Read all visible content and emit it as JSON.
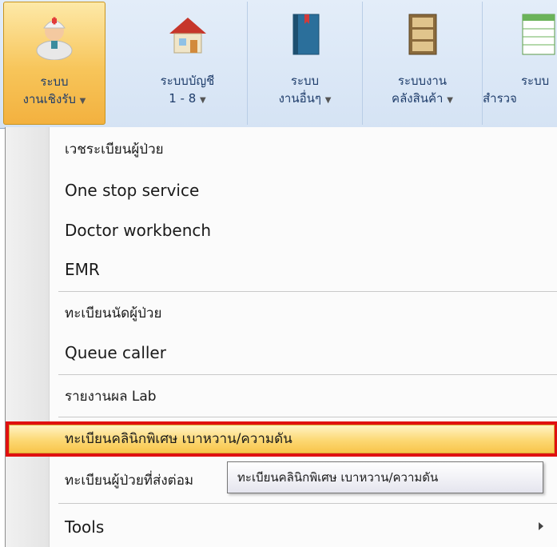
{
  "ribbon": {
    "buttons": [
      {
        "line1": "ระบบ",
        "line2": "งานเชิงรับ",
        "icon": "nurse-icon",
        "active": true
      },
      {
        "line1": "ระบบบัญชี",
        "line2": "1 - 8",
        "icon": "house-icon"
      },
      {
        "line1": "ระบบ",
        "line2": "งานอื่นๆ",
        "icon": "book-icon"
      },
      {
        "line1": "ระบบงาน",
        "line2": "คลังสินค้า",
        "icon": "cabinet-icon"
      },
      {
        "line1": "ระบบ",
        "line2": "สำรวจ",
        "icon": "sheet-icon"
      }
    ]
  },
  "menu": {
    "items": [
      "เวชระเบียนผู้ป่วย",
      "One stop service",
      "Doctor workbench",
      "EMR",
      "ทะเบียนนัดผู้ป่วย",
      "Queue caller",
      "รายงานผล Lab",
      "ทะเบียนคลินิกพิเศษ เบาหวาน/ความดัน",
      "ทะเบียนผู้ป่วยที่ส่งต่อม",
      "Tools"
    ],
    "highlighted_index": 7
  },
  "tooltip": {
    "text": "ทะเบียนคลินิกพิเศษ เบาหวาน/ความดัน"
  },
  "colors": {
    "ribbon_bg": "#dbe7f6",
    "active_button": "#f7c55a",
    "highlight_border": "#e01010"
  }
}
